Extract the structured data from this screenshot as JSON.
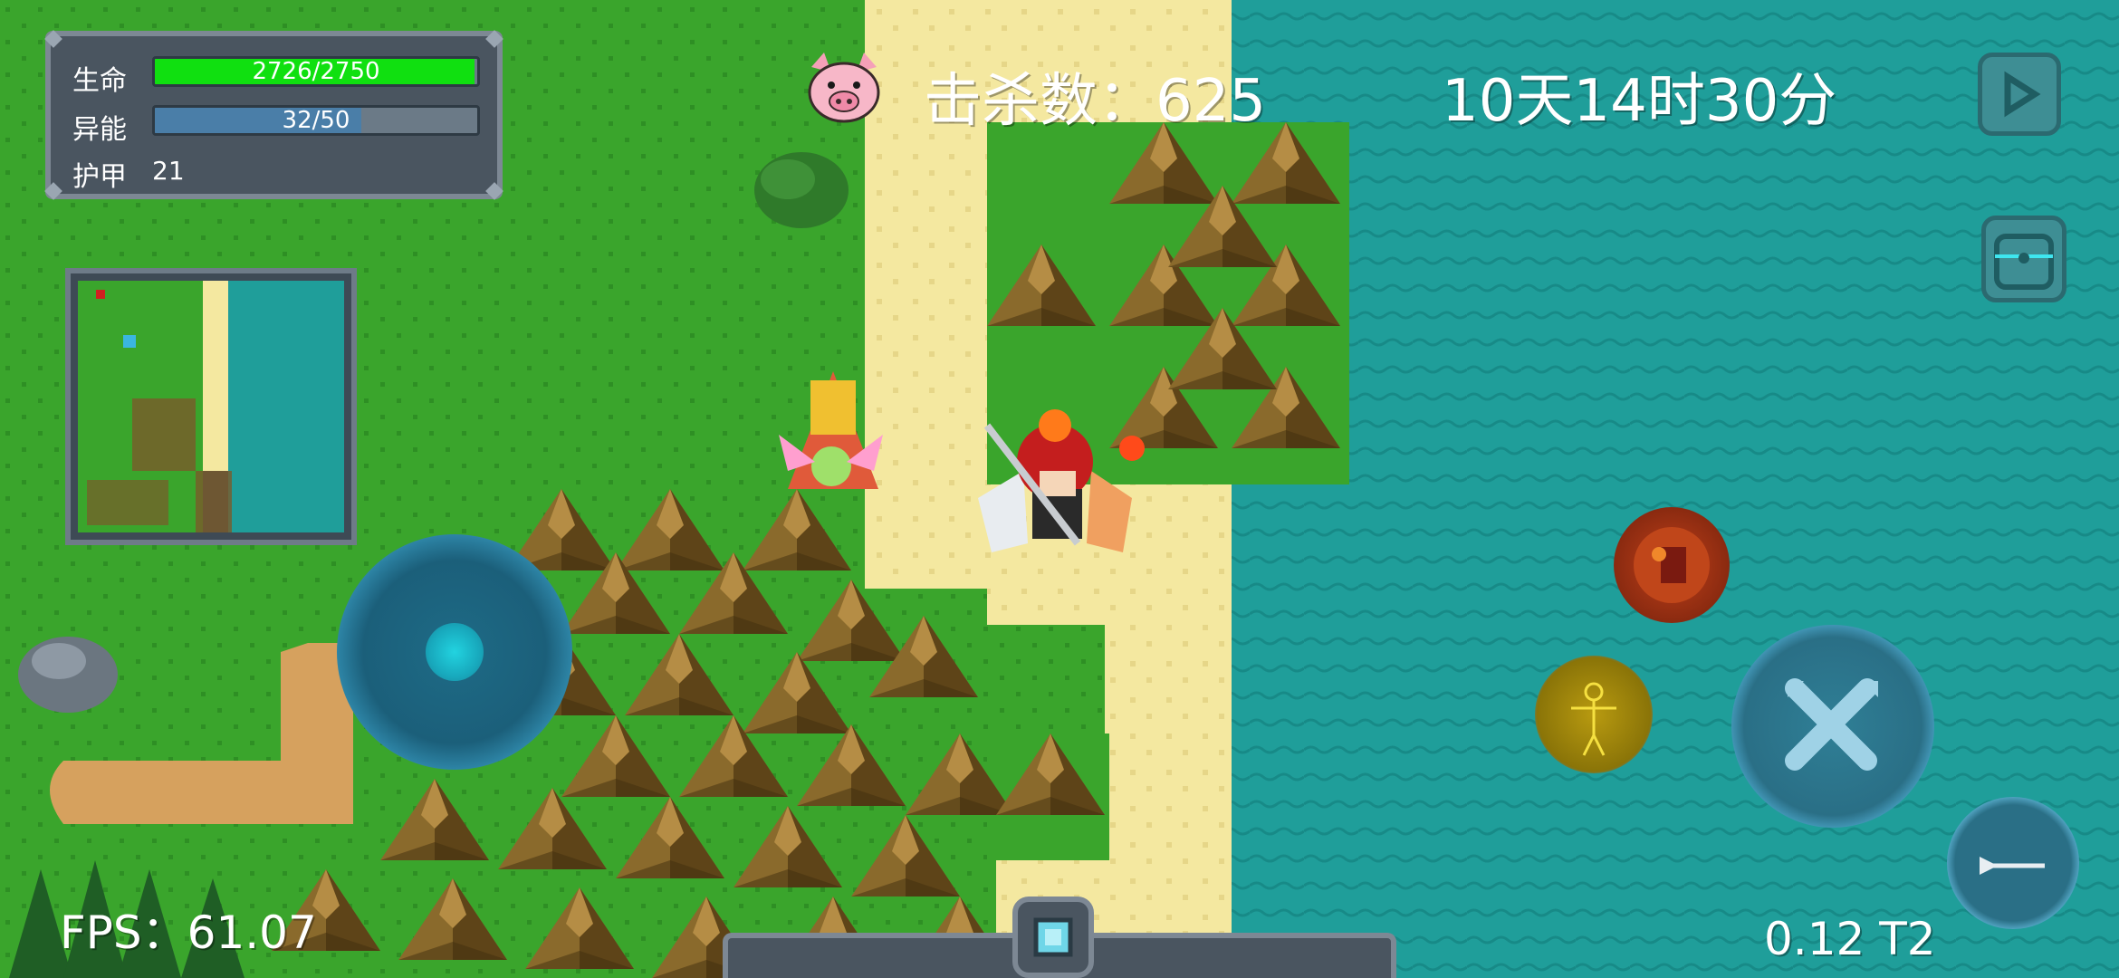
{
  "hud": {
    "stats": {
      "hp_label": "生命",
      "hp_value": "2726/2750",
      "hp_current": 2726,
      "hp_max": 2750,
      "energy_label": "异能",
      "energy_value": "32/50",
      "energy_current": 32,
      "energy_max": 50,
      "armor_label": "护甲",
      "armor_value": "21"
    },
    "kills_label": "击杀数：625",
    "game_time": "10天14时30分",
    "fps_label": "FPS：61.07",
    "version_label": "0.12 T2"
  },
  "icons": {
    "pig": "pig-icon",
    "play": "play-icon",
    "backpack": "backpack-icon",
    "fire_skill": "fireball-skill-icon",
    "body_skill": "body-skill-icon",
    "attack": "crossed-swords-icon",
    "weapon": "spear-icon",
    "inventory_gem": "gem-icon"
  },
  "colors": {
    "grass": "#3aa52c",
    "sand": "#f4e8a0",
    "water": "#1f9e9a",
    "hp_bar": "#10e010",
    "energy_bar": "#4a7ea8",
    "panel": "#4a5560"
  }
}
